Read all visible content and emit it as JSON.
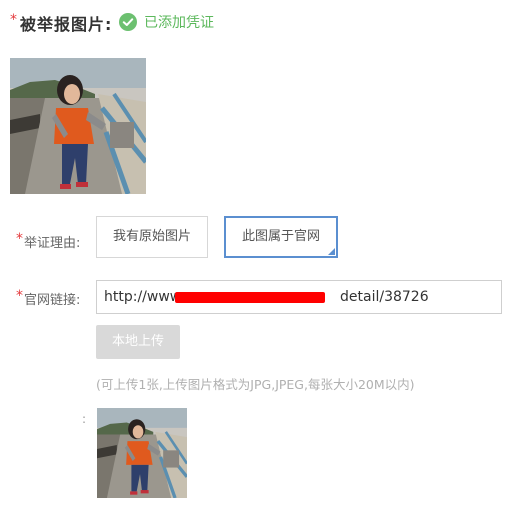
{
  "header": {
    "required_mark": "*",
    "title": "被举报图片:",
    "status_text": "已添加凭证",
    "status_color": "#5cb85c",
    "status_icon": "check-circle-icon"
  },
  "reason": {
    "required_mark": "*",
    "label": "举证理由:",
    "options": [
      "我有原始图片",
      "此图属于官网"
    ],
    "selected_index": 1
  },
  "official_link": {
    "required_mark": "*",
    "label": "官网链接:",
    "value_prefix": "http://www",
    "value_suffix": "detail/38726",
    "redaction_color": "#ff0000"
  },
  "upload": {
    "button_label": "本地上传",
    "hint": "(可上传1张,上传图片格式为JPG,JPEG,每张大小20M以内)",
    "thumb_label": ":"
  },
  "colors": {
    "required": "#e4393c",
    "selected_border": "#5b8fd0",
    "disabled_button": "#d9d9d9"
  }
}
